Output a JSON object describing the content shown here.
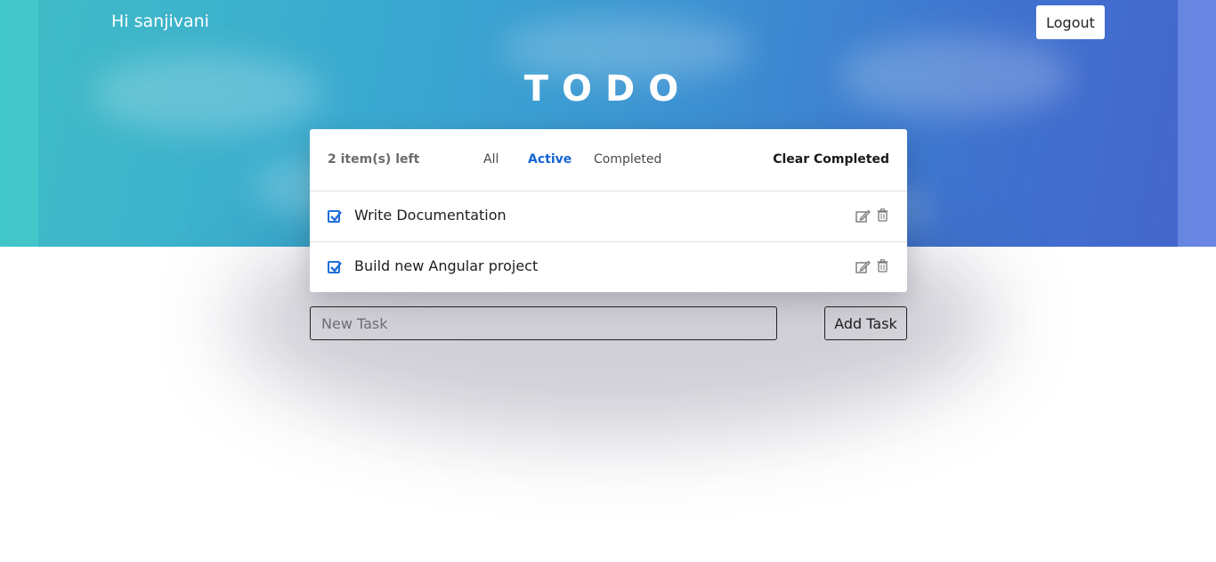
{
  "header": {
    "greeting": "Hi sanjivani",
    "logout_label": "Logout"
  },
  "app": {
    "title": "TODO"
  },
  "todo_card": {
    "items_left": "2 item(s) left",
    "filters": {
      "all": "All",
      "active": "Active",
      "completed": "Completed",
      "selected": "Active"
    },
    "clear_completed": "Clear Completed",
    "tasks": [
      {
        "text": "Write Documentation",
        "checked": true
      },
      {
        "text": "Build new Angular project",
        "checked": true
      }
    ]
  },
  "new_task": {
    "placeholder": "New Task",
    "value": "",
    "add_label": "Add Task"
  },
  "colors": {
    "accent": "#1565d8",
    "hero_start": "#3fbbc6",
    "hero_end": "#4466cc"
  },
  "icons": {
    "checkbox": "checked-checkbox-icon",
    "edit": "edit-pencil-icon",
    "delete": "trash-icon"
  }
}
